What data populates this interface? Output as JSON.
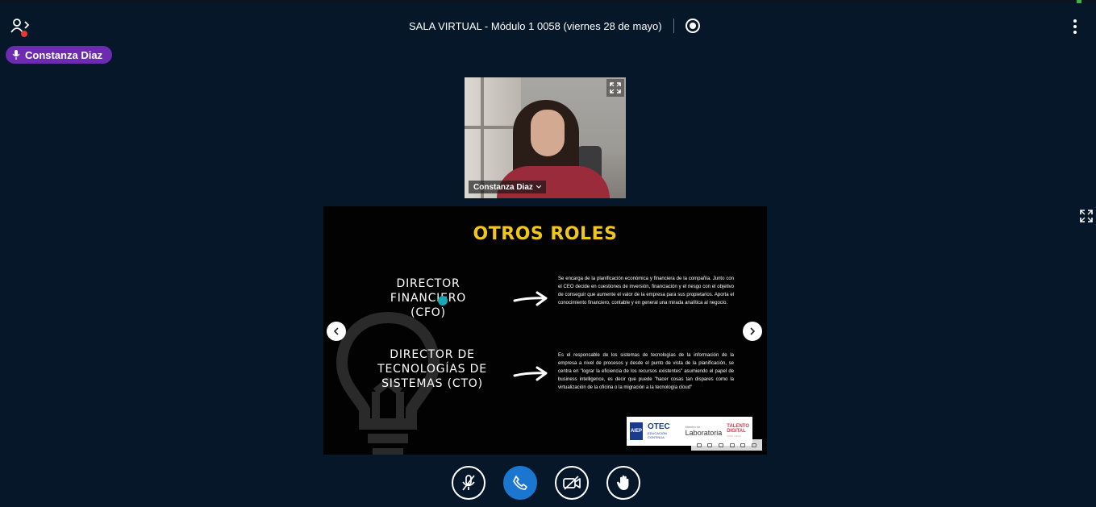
{
  "header": {
    "meeting_title": "SALA VIRTUAL - Módulo 1 0058 (viernes 28 de mayo)"
  },
  "talking_indicator": {
    "name": "Constanza Diaz"
  },
  "webcam": {
    "name": "Constanza Diaz"
  },
  "slide": {
    "title": "OTROS ROLES",
    "role1": [
      "DIRECTOR",
      "FINANCIERO",
      "(CFO)"
    ],
    "role2": [
      "DIRECTOR DE",
      "TECNOLOGÍAS DE",
      "SISTEMAS (CTO)"
    ],
    "desc1": "Se encarga de la planificación económica y financiera de la compañía. Junto con el CEO decide en cuestiones de inversión, financiación y el riesgo con el objetivo de conseguir que aumente el valor de la empresa para sus propietarios. Aporta el conocimiento financiero, contable y en general una mirada analítica al negocio.",
    "desc2": "Es el responsable de los sistemas de tecnologías de la información de la empresa a nivel de procesos y desde el punto de vista de la planificación, se centra en \"lograr la eficiencia de los recursos existentes\" asumiendo el papel de business intelligence, es decir que puede \"hacer cosas tan dispares como la virtualización de la oficina o la migración a la tecnología cloud\"",
    "logos": {
      "aiep": "AIEP",
      "otec": "OTEC",
      "otec_sub": "EDUCACIÓN CONTINUA",
      "lab_small": "Miembro de",
      "lab": "Laboratoria",
      "talento": [
        "TALENTO",
        "DIGITAL"
      ],
      "talento_sub": "PARA CHILE"
    }
  },
  "controls": {
    "mic": "microphone-muted-icon",
    "phone": "phone-icon",
    "camera": "camera-off-icon",
    "hand": "raise-hand-icon"
  },
  "colors": {
    "background": "#06172a",
    "talker_badge": "#6c2bb0",
    "slide_title": "#f2c619",
    "primary_button": "#1b76cf"
  }
}
